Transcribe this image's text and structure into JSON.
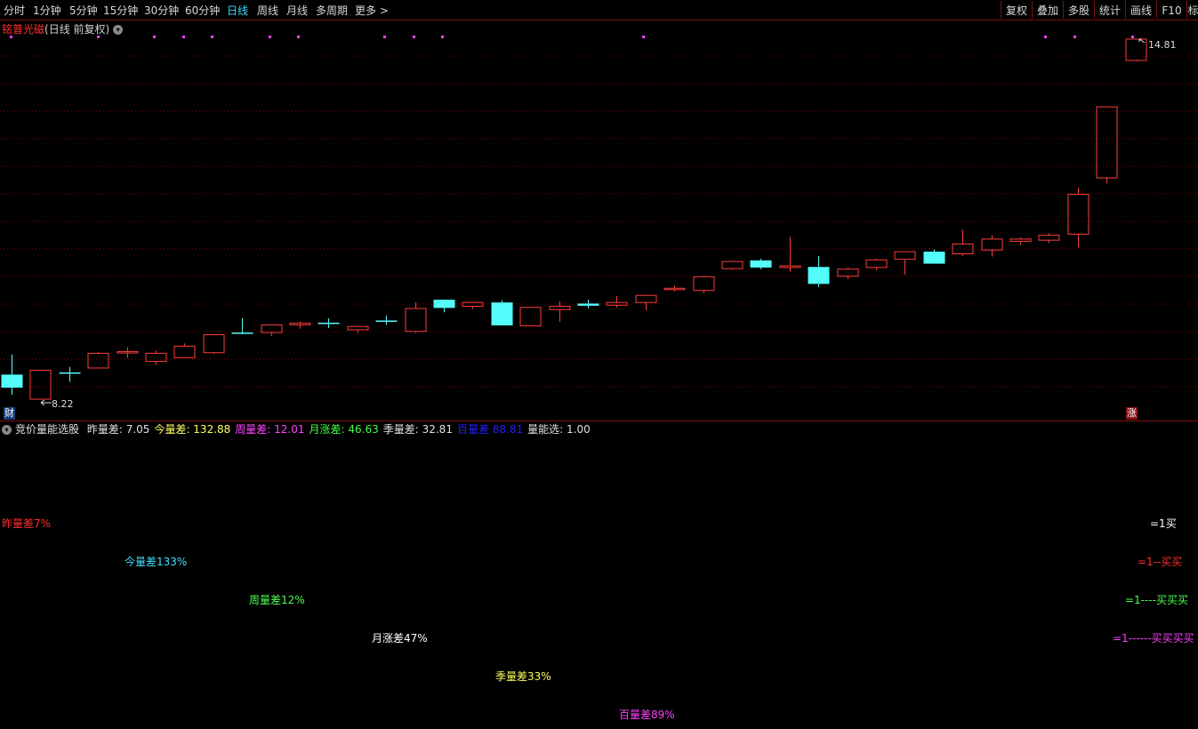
{
  "toolbar": {
    "periods": [
      "分时",
      "1分钟",
      "5分钟",
      "15分钟",
      "30分钟",
      "60分钟",
      "日线",
      "周线",
      "月线",
      "多周期",
      "更多 >"
    ],
    "active": "日线",
    "right_buttons": [
      "复权",
      "叠加",
      "多股",
      "统计",
      "画线",
      "F10",
      "标"
    ]
  },
  "chart": {
    "stock_name": "铭普光磁",
    "period_label": "(日线 前复权)",
    "high_label": "14.81",
    "low_label": "8.22",
    "badge_left": "财",
    "badge_right": "涨"
  },
  "chart_data": {
    "type": "candlestick",
    "y_range": [
      8.0,
      15.0
    ],
    "annotations": {
      "max": 14.81,
      "min": 8.22
    },
    "candles": [
      {
        "o": 8.43,
        "c": 8.67,
        "h": 9.04,
        "l": 8.3,
        "color": "cyan"
      },
      {
        "o": 8.22,
        "c": 8.75,
        "h": 8.75,
        "l": 8.22,
        "color": "red"
      },
      {
        "o": 8.7,
        "c": 8.71,
        "h": 8.81,
        "l": 8.54,
        "color": "cyan"
      },
      {
        "o": 8.79,
        "c": 9.06,
        "h": 9.08,
        "l": 8.79,
        "color": "red"
      },
      {
        "o": 9.07,
        "c": 9.09,
        "h": 9.17,
        "l": 8.97,
        "color": "red"
      },
      {
        "o": 8.91,
        "c": 9.06,
        "h": 9.11,
        "l": 8.85,
        "color": "red"
      },
      {
        "o": 8.98,
        "c": 9.19,
        "h": 9.24,
        "l": 8.97,
        "color": "red"
      },
      {
        "o": 9.07,
        "c": 9.4,
        "h": 9.41,
        "l": 9.05,
        "color": "red"
      },
      {
        "o": 9.43,
        "c": 9.44,
        "h": 9.7,
        "l": 9.41,
        "color": "cyan"
      },
      {
        "o": 9.44,
        "c": 9.58,
        "h": 9.59,
        "l": 9.38,
        "color": "red"
      },
      {
        "o": 9.58,
        "c": 9.61,
        "h": 9.64,
        "l": 9.51,
        "color": "red"
      },
      {
        "o": 9.61,
        "c": 9.62,
        "h": 9.7,
        "l": 9.52,
        "color": "cyan"
      },
      {
        "o": 9.49,
        "c": 9.55,
        "h": 9.56,
        "l": 9.43,
        "color": "red"
      },
      {
        "o": 9.65,
        "c": 9.66,
        "h": 9.75,
        "l": 9.58,
        "color": "cyan"
      },
      {
        "o": 9.46,
        "c": 9.88,
        "h": 9.99,
        "l": 9.43,
        "color": "red"
      },
      {
        "o": 10.04,
        "c": 9.89,
        "h": 10.04,
        "l": 9.81,
        "color": "cyan"
      },
      {
        "o": 9.92,
        "c": 9.99,
        "h": 10.0,
        "l": 9.87,
        "color": "red"
      },
      {
        "o": 9.99,
        "c": 9.57,
        "h": 10.03,
        "l": 9.57,
        "color": "cyan"
      },
      {
        "o": 9.56,
        "c": 9.9,
        "h": 9.9,
        "l": 9.56,
        "color": "red"
      },
      {
        "o": 9.86,
        "c": 9.92,
        "h": 10.01,
        "l": 9.64,
        "color": "red"
      },
      {
        "o": 9.93,
        "c": 9.97,
        "h": 10.04,
        "l": 9.88,
        "color": "cyan"
      },
      {
        "o": 9.94,
        "c": 9.99,
        "h": 10.11,
        "l": 9.9,
        "color": "red"
      },
      {
        "o": 9.99,
        "c": 10.12,
        "h": 10.13,
        "l": 9.85,
        "color": "red"
      },
      {
        "o": 10.23,
        "c": 10.25,
        "h": 10.3,
        "l": 10.19,
        "color": "red"
      },
      {
        "o": 10.21,
        "c": 10.46,
        "h": 10.48,
        "l": 10.16,
        "color": "red"
      },
      {
        "o": 10.61,
        "c": 10.74,
        "h": 10.75,
        "l": 10.59,
        "color": "red"
      },
      {
        "o": 10.76,
        "c": 10.63,
        "h": 10.79,
        "l": 10.6,
        "color": "cyan"
      },
      {
        "o": 10.63,
        "c": 10.66,
        "h": 11.19,
        "l": 10.55,
        "color": "red"
      },
      {
        "o": 10.64,
        "c": 10.33,
        "h": 10.84,
        "l": 10.27,
        "color": "cyan"
      },
      {
        "o": 10.47,
        "c": 10.6,
        "h": 10.63,
        "l": 10.42,
        "color": "red"
      },
      {
        "o": 10.63,
        "c": 10.77,
        "h": 10.79,
        "l": 10.58,
        "color": "red"
      },
      {
        "o": 10.78,
        "c": 10.92,
        "h": 10.92,
        "l": 10.5,
        "color": "red"
      },
      {
        "o": 10.7,
        "c": 10.92,
        "h": 10.96,
        "l": 10.7,
        "color": "cyan"
      },
      {
        "o": 10.88,
        "c": 11.06,
        "h": 11.32,
        "l": 10.84,
        "color": "red"
      },
      {
        "o": 10.95,
        "c": 11.15,
        "h": 11.22,
        "l": 10.83,
        "color": "red"
      },
      {
        "o": 11.11,
        "c": 11.15,
        "h": 11.18,
        "l": 11.05,
        "color": "red"
      },
      {
        "o": 11.13,
        "c": 11.22,
        "h": 11.26,
        "l": 11.08,
        "color": "red"
      },
      {
        "o": 11.24,
        "c": 11.97,
        "h": 12.09,
        "l": 11.0,
        "color": "red"
      },
      {
        "o": 12.27,
        "c": 13.57,
        "h": 13.57,
        "l": 12.17,
        "color": "red"
      },
      {
        "o": 14.42,
        "c": 14.81,
        "h": 14.81,
        "l": 14.4,
        "color": "red"
      }
    ]
  },
  "indicator": {
    "name": "竞价量能选股",
    "values": [
      {
        "label": "昨量差:",
        "value": "7.05",
        "color": "#e0e0e0"
      },
      {
        "label": "今量差:",
        "value": "132.88",
        "color": "#ffff66"
      },
      {
        "label": "周量差:",
        "value": "12.01",
        "color": "#ff44ff"
      },
      {
        "label": "月涨差:",
        "value": "46.63",
        "color": "#44ff44"
      },
      {
        "label": "季量差:",
        "value": "32.81",
        "color": "#e0e0e0"
      },
      {
        "label": "百量差",
        "value": "88.81",
        "color": "#2020ff"
      },
      {
        "label": "量能选:",
        "value": "1.00",
        "color": "#e0e0e0"
      }
    ]
  },
  "signal_labels": [
    {
      "text": "昨量差7%",
      "color": "#ff3030"
    },
    {
      "text": "今量差133%",
      "color": "#40e0ff"
    },
    {
      "text": "周量差12%",
      "color": "#50ff50"
    },
    {
      "text": "月涨差47%",
      "color": "#ffffff"
    },
    {
      "text": "季量差33%",
      "color": "#ffff60"
    },
    {
      "text": "百量差89%",
      "color": "#ff40ff"
    }
  ],
  "buy_labels": [
    {
      "text": "=1买",
      "color": "#ffffff"
    },
    {
      "text": "=1--买买",
      "color": "#ff3030"
    },
    {
      "text": "=1----买买买",
      "color": "#50ff50"
    },
    {
      "text": "=1------买买买买",
      "color": "#ff40ff"
    }
  ],
  "colors": {
    "up": "#ff3c3c",
    "down": "#54fcfc",
    "grid": "#8a0000",
    "marker": "#ff40ff"
  }
}
